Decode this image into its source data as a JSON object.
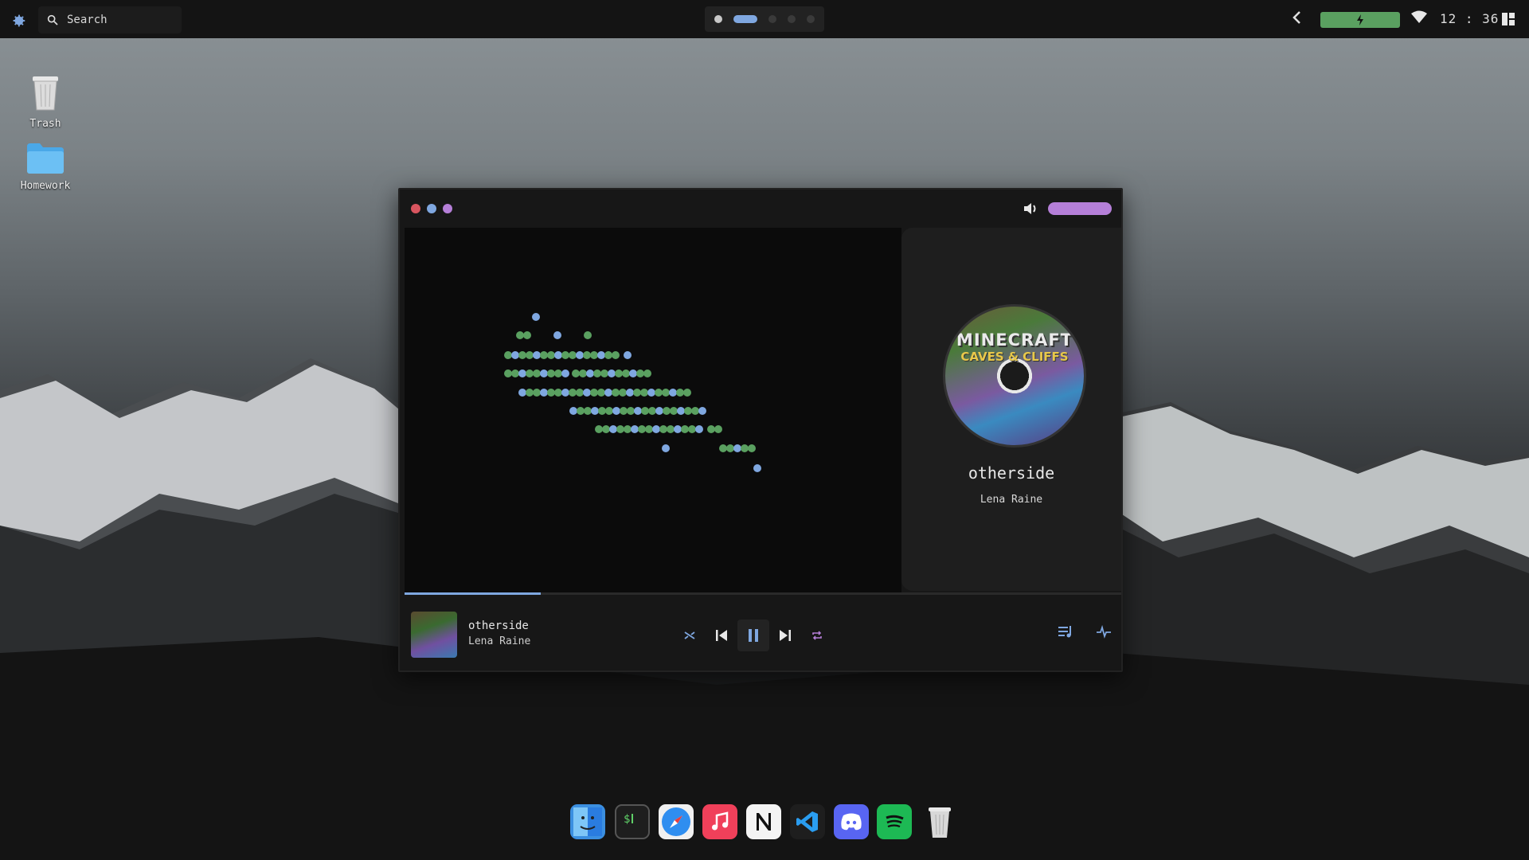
{
  "topbar": {
    "search_placeholder": "Search",
    "clock": "12 : 36",
    "workspaces": [
      "filled",
      "active",
      "empty",
      "empty",
      "empty"
    ]
  },
  "desktop_icons": [
    {
      "label": "Trash",
      "icon": "trash-icon"
    },
    {
      "label": "Homework",
      "icon": "folder-icon"
    }
  ],
  "player_window": {
    "volume_level": 1.0,
    "now_playing": {
      "title": "otherside",
      "artist": "Lena Raine"
    },
    "album_art_text": {
      "line1": "MINECRAFT",
      "line2": "CAVES & CLIFFS"
    },
    "progress": 0.19,
    "controls": [
      "shuffle-icon",
      "previous-icon",
      "pause-icon",
      "next-icon",
      "repeat-icon"
    ],
    "right_controls": [
      "queue-icon",
      "visualizer-icon"
    ]
  },
  "dock": [
    {
      "name": "finder",
      "color": "#3b8fe0"
    },
    {
      "name": "terminal",
      "color": "#2a2a2a"
    },
    {
      "name": "safari",
      "color": "#2f8ef0"
    },
    {
      "name": "music",
      "color": "#f0405a"
    },
    {
      "name": "notion",
      "color": "#f2f2f2"
    },
    {
      "name": "vscode",
      "color": "#1e1e1e"
    },
    {
      "name": "discord",
      "color": "#5865f2"
    },
    {
      "name": "spotify",
      "color": "#1db954"
    },
    {
      "name": "trash",
      "color": "#cfcfcf"
    }
  ],
  "colors": {
    "accent_blue": "#7fa7e0",
    "accent_green": "#5aa060",
    "accent_purple": "#b57fd8",
    "close_red": "#d8555f"
  }
}
